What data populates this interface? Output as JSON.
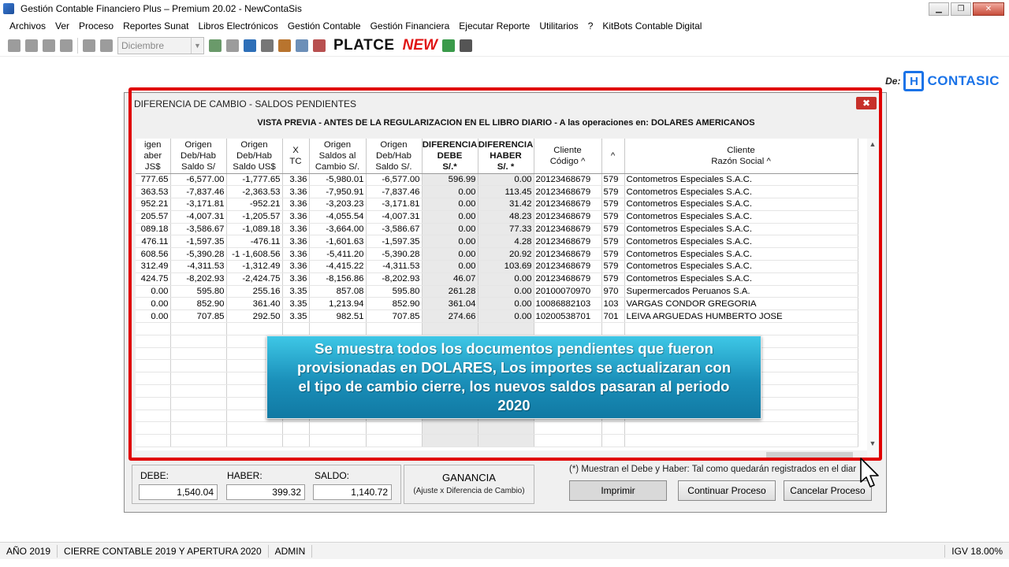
{
  "window": {
    "title": "Gestión Contable Financiero Plus – Premium 20.02 - NewContaSis",
    "min_icon": "minimize-icon",
    "max_icon": "restore-icon",
    "close_icon": "close-icon"
  },
  "menu": [
    "Archivos",
    "Ver",
    "Proceso",
    "Reportes Sunat",
    "Libros Electrónicos",
    "Gestión Contable",
    "Gestión Financiera",
    "Ejecutar Reporte",
    "Utilitarios",
    "?",
    "KitBots Contable Digital"
  ],
  "toolbar": {
    "month": "Diciembre",
    "platce_label": "PLATCE",
    "new_label": "NEW"
  },
  "brand": {
    "prefix": "De:",
    "logo_letter": "H",
    "name": "CONTASIC"
  },
  "dialog": {
    "title": "DIFERENCIA DE CAMBIO - SALDOS PENDIENTES",
    "close_label": "✖",
    "preview_header": "VISTA PREVIA - ANTES DE LA REGULARIZACION EN EL LIBRO DIARIO - A las operaciones en: DOLARES AMERICANOS"
  },
  "grid": {
    "columns": [
      "igen\naber\nJS$",
      "Origen\nDeb/Hab\nSaldo S/",
      "Origen\nDeb/Hab\nSaldo US$",
      "X\nTC",
      "Origen\nSaldos al\nCambio S/.",
      "Origen\nDeb/Hab\nSaldo S/.",
      "DIFERENCIA\nDEBE\nS/.*",
      "DIFERENCIA\nHABER\nS/. *",
      "Cliente\nCódigo ^",
      "^",
      "Cliente\nRazón Social ^"
    ],
    "rows": [
      [
        "777.65",
        "-6,577.00",
        "-1,777.65",
        "3.36",
        "-5,980.01",
        "-6,577.00",
        "596.99",
        "0.00",
        "20123468679",
        "579",
        "Contometros Especiales S.A.C."
      ],
      [
        "363.53",
        "-7,837.46",
        "-2,363.53",
        "3.36",
        "-7,950.91",
        "-7,837.46",
        "0.00",
        "113.45",
        "20123468679",
        "579",
        "Contometros Especiales S.A.C."
      ],
      [
        "952.21",
        "-3,171.81",
        "-952.21",
        "3.36",
        "-3,203.23",
        "-3,171.81",
        "0.00",
        "31.42",
        "20123468679",
        "579",
        "Contometros Especiales S.A.C."
      ],
      [
        "205.57",
        "-4,007.31",
        "-1,205.57",
        "3.36",
        "-4,055.54",
        "-4,007.31",
        "0.00",
        "48.23",
        "20123468679",
        "579",
        "Contometros Especiales S.A.C."
      ],
      [
        "089.18",
        "-3,586.67",
        "-1,089.18",
        "3.36",
        "-3,664.00",
        "-3,586.67",
        "0.00",
        "77.33",
        "20123468679",
        "579",
        "Contometros Especiales S.A.C."
      ],
      [
        "476.11",
        "-1,597.35",
        "-476.11",
        "3.36",
        "-1,601.63",
        "-1,597.35",
        "0.00",
        "4.28",
        "20123468679",
        "579",
        "Contometros Especiales S.A.C."
      ],
      [
        "608.56",
        "-5,390.28",
        "-1    -1,608.56",
        "3.36",
        "-5,411.20",
        "-5,390.28",
        "0.00",
        "20.92",
        "20123468679",
        "579",
        "Contometros Especiales S.A.C."
      ],
      [
        "312.49",
        "-4,311.53",
        "-1,312.49",
        "3.36",
        "-4,415.22",
        "-4,311.53",
        "0.00",
        "103.69",
        "20123468679",
        "579",
        "Contometros Especiales S.A.C."
      ],
      [
        "424.75",
        "-8,202.93",
        "-2,424.75",
        "3.36",
        "-8,156.86",
        "-8,202.93",
        "46.07",
        "0.00",
        "20123468679",
        "579",
        "Contometros Especiales S.A.C."
      ],
      [
        "0.00",
        "595.80",
        "255.16",
        "3.35",
        "857.08",
        "595.80",
        "261.28",
        "0.00",
        "20100070970",
        "970",
        "Supermercados Peruanos S.A."
      ],
      [
        "0.00",
        "852.90",
        "361.40",
        "3.35",
        "1,213.94",
        "852.90",
        "361.04",
        "0.00",
        "10086882103",
        "103",
        "VARGAS CONDOR GREGORIA"
      ],
      [
        "0.00",
        "707.85",
        "292.50",
        "3.35",
        "982.51",
        "707.85",
        "274.66",
        "0.00",
        "10200538701",
        "701",
        "LEIVA ARGUEDAS HUMBERTO JOSE"
      ]
    ],
    "empty_rows": 10
  },
  "caption": "Se muestra todos los documentos pendientes que fueron provisionadas en DOLARES, Los importes se actualizaran con el tipo de cambio cierre, los nuevos saldos pasaran al periodo 2020",
  "summary": {
    "debe_label": "DEBE:",
    "debe_value": "1,540.04",
    "haber_label": "HABER:",
    "haber_value": "399.32",
    "saldo_label": "SALDO:",
    "saldo_value": "1,140.72"
  },
  "ganancia": {
    "title": "GANANCIA",
    "subtitle": "(Ajuste x Diferencia de Cambio)"
  },
  "note": "(*) Muestran el Debe y Haber: Tal como quedarán registrados en el diar",
  "buttons": {
    "print": "Imprimir",
    "continue": "Continuar Proceso",
    "cancel": "Cancelar Proceso"
  },
  "status": {
    "year": "AÑO 2019",
    "process": "CIERRE CONTABLE 2019 Y APERTURA 2020",
    "user": "ADMIN",
    "igv": "IGV 18.00%"
  }
}
